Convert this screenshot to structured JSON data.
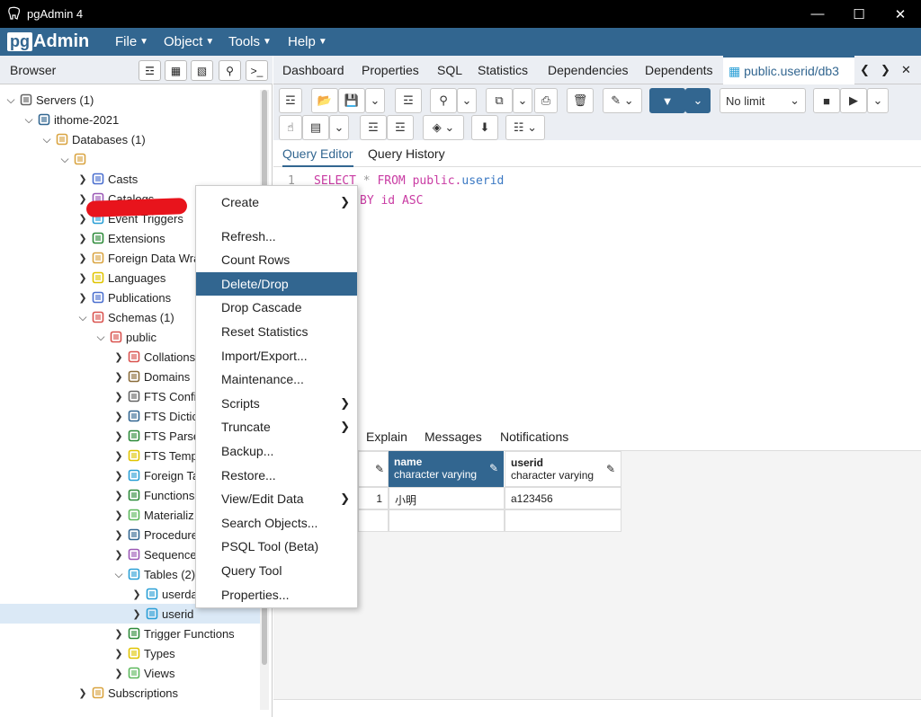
{
  "window": {
    "title": "pgAdmin 4"
  },
  "menu": {
    "brand_pg": "pg",
    "brand_admin": "Admin",
    "items": [
      "File",
      "Object",
      "Tools",
      "Help"
    ]
  },
  "browser": {
    "label": "Browser"
  },
  "tree": [
    {
      "label": "Servers (1)",
      "indent": 0,
      "open": true,
      "icon": "servers-icon",
      "color": "#666"
    },
    {
      "label": "ithome-2021",
      "indent": 1,
      "open": true,
      "icon": "elephant-icon",
      "color": "#336791"
    },
    {
      "label": "Databases (1)",
      "indent": 2,
      "open": true,
      "icon": "databases-icon",
      "color": "#d9a441"
    },
    {
      "label": "",
      "indent": 3,
      "open": true,
      "icon": "database-icon",
      "color": "#d9a441"
    },
    {
      "label": "Casts",
      "indent": 4,
      "open": false,
      "icon": "casts-icon",
      "color": "#4b6fcf"
    },
    {
      "label": "Catalogs",
      "indent": 4,
      "open": false,
      "icon": "catalogs-icon",
      "color": "#9b59b6"
    },
    {
      "label": "Event Triggers",
      "indent": 4,
      "open": false,
      "icon": "event-triggers-icon",
      "color": "#2a9fd6"
    },
    {
      "label": "Extensions",
      "indent": 4,
      "open": false,
      "icon": "extensions-icon",
      "color": "#2e8b3a"
    },
    {
      "label": "Foreign Data Wra",
      "indent": 4,
      "open": false,
      "icon": "foreign-data-wrappers-icon",
      "color": "#d9a441"
    },
    {
      "label": "Languages",
      "indent": 4,
      "open": false,
      "icon": "languages-icon",
      "color": "#e0c400"
    },
    {
      "label": "Publications",
      "indent": 4,
      "open": false,
      "icon": "publications-icon",
      "color": "#4b6fcf"
    },
    {
      "label": "Schemas (1)",
      "indent": 4,
      "open": true,
      "icon": "schemas-icon",
      "color": "#d9534f"
    },
    {
      "label": "public",
      "indent": 5,
      "open": true,
      "icon": "schema-icon",
      "color": "#d9534f"
    },
    {
      "label": "Collations",
      "indent": 6,
      "open": false,
      "icon": "collations-icon",
      "color": "#d9534f"
    },
    {
      "label": "Domains",
      "indent": 6,
      "open": false,
      "icon": "domains-icon",
      "color": "#8a6d3b"
    },
    {
      "label": "FTS Confi",
      "indent": 6,
      "open": false,
      "icon": "fts-config-icon",
      "color": "#666"
    },
    {
      "label": "FTS Dictic",
      "indent": 6,
      "open": false,
      "icon": "fts-dictionary-icon",
      "color": "#336791"
    },
    {
      "label": "FTS Parse",
      "indent": 6,
      "open": false,
      "icon": "fts-parser-icon",
      "color": "#2e8b3a"
    },
    {
      "label": "FTS Temp",
      "indent": 6,
      "open": false,
      "icon": "fts-template-icon",
      "color": "#e0c400"
    },
    {
      "label": "Foreign Ta",
      "indent": 6,
      "open": false,
      "icon": "foreign-table-icon",
      "color": "#2a9fd6"
    },
    {
      "label": "Functions",
      "indent": 6,
      "open": false,
      "icon": "functions-icon",
      "color": "#2e8b3a"
    },
    {
      "label": "Materializ",
      "indent": 6,
      "open": false,
      "icon": "materialized-views-icon",
      "color": "#5cb85c"
    },
    {
      "label": "Procedure",
      "indent": 6,
      "open": false,
      "icon": "procedures-icon",
      "color": "#336791"
    },
    {
      "label": "Sequence",
      "indent": 6,
      "open": false,
      "icon": "sequences-icon",
      "color": "#9b59b6"
    },
    {
      "label": "Tables (2)",
      "indent": 6,
      "open": true,
      "icon": "tables-icon",
      "color": "#2a9fd6"
    },
    {
      "label": "userda",
      "indent": 7,
      "open": false,
      "icon": "table-icon",
      "color": "#2a9fd6"
    },
    {
      "label": "userid",
      "indent": 7,
      "open": false,
      "icon": "table-icon",
      "color": "#2a9fd6",
      "selected": true
    },
    {
      "label": "Trigger Functions",
      "indent": 6,
      "open": false,
      "icon": "trigger-functions-icon",
      "color": "#2e8b3a"
    },
    {
      "label": "Types",
      "indent": 6,
      "open": false,
      "icon": "types-icon",
      "color": "#e0c400"
    },
    {
      "label": "Views",
      "indent": 6,
      "open": false,
      "icon": "views-icon",
      "color": "#5cb85c"
    },
    {
      "label": "Subscriptions",
      "indent": 4,
      "open": false,
      "icon": "subscriptions-icon",
      "color": "#d9a441"
    }
  ],
  "tabs": [
    "Dashboard",
    "Properties",
    "SQL",
    "Statistics",
    "Dependencies",
    "Dependents"
  ],
  "active_tab": "public.userid/db3",
  "toolbar": {
    "limit": "No limit"
  },
  "query_tabs": {
    "editor": "Query Editor",
    "history": "Query History"
  },
  "editor": {
    "line1_no": "1",
    "line1_kw1": "SELECT",
    "line1_star": " * ",
    "line1_kw2": "FROM",
    "line1_rest": " public.",
    "line1_tbl": "userid",
    "line2_kw": "BY",
    "line2_rest": " id ",
    "line2_kw2": "ASC"
  },
  "output_tabs": [
    "Explain",
    "Messages",
    "Notifications"
  ],
  "grid": {
    "columns": [
      {
        "name": "name",
        "type": "character varying"
      },
      {
        "name": "userid",
        "type": "character varying"
      }
    ],
    "rows": [
      {
        "num": "1",
        "name": "小明",
        "userid": "a123456"
      }
    ]
  },
  "context_menu": [
    {
      "label": "Create",
      "submenu": true
    },
    {
      "label": "Refresh...",
      "sep": true
    },
    {
      "label": "Count Rows"
    },
    {
      "label": "Delete/Drop",
      "selected": true
    },
    {
      "label": "Drop Cascade"
    },
    {
      "label": "Reset Statistics"
    },
    {
      "label": "Import/Export..."
    },
    {
      "label": "Maintenance..."
    },
    {
      "label": "Scripts",
      "submenu": true
    },
    {
      "label": "Truncate",
      "submenu": true
    },
    {
      "label": "Backup..."
    },
    {
      "label": "Restore..."
    },
    {
      "label": "View/Edit Data",
      "submenu": true
    },
    {
      "label": "Search Objects..."
    },
    {
      "label": "PSQL Tool (Beta)"
    },
    {
      "label": "Query Tool"
    },
    {
      "label": "Properties..."
    }
  ]
}
